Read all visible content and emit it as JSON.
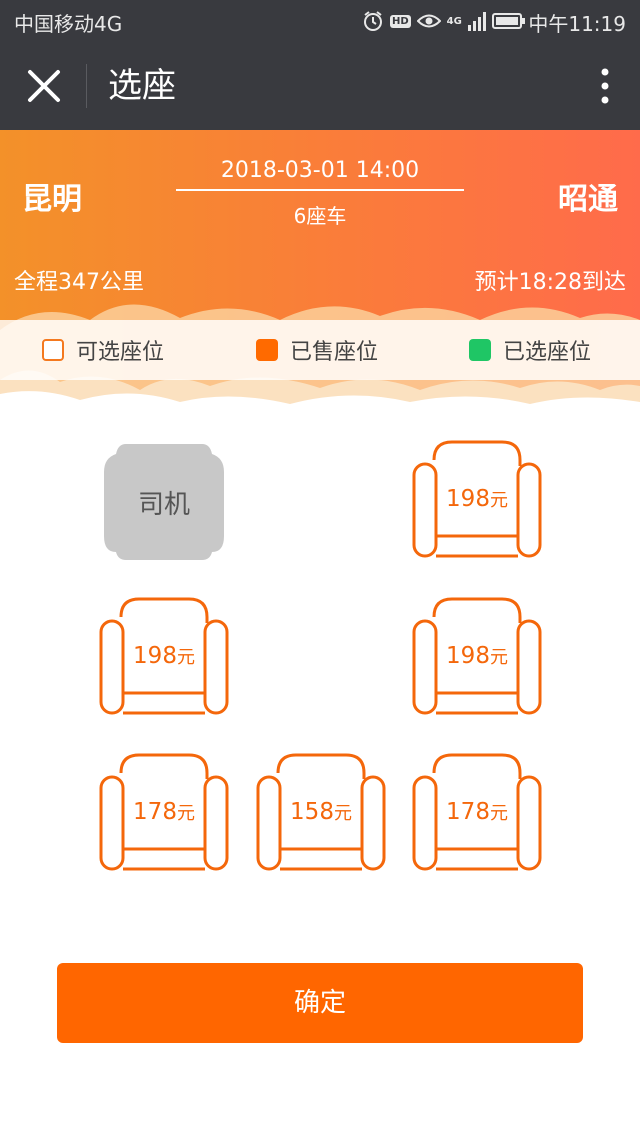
{
  "status_bar": {
    "carrier": "中国移动4G",
    "hd_label": "HD",
    "network_label": "4G",
    "time": "中午11:19",
    "icons": [
      "alarm-icon",
      "hd-icon",
      "eye-icon",
      "signal-icon",
      "battery-icon"
    ]
  },
  "nav": {
    "title": "选座",
    "close_icon": "close-icon",
    "more_icon": "more-vertical-icon"
  },
  "trip": {
    "from": "昆明",
    "to": "昭通",
    "depart_time": "2018-03-01 14:00",
    "car_type": "6座车",
    "distance": "全程347公里",
    "arrival": "预计18:28到达"
  },
  "legend": [
    {
      "label": "可选座位",
      "color": "#f4791f",
      "state": "available"
    },
    {
      "label": "已售座位",
      "color": "#ff6a00",
      "state": "sold"
    },
    {
      "label": "已选座位",
      "color": "#1fc665",
      "state": "selected"
    }
  ],
  "driver": {
    "label": "司机"
  },
  "seats": [
    {
      "price": "198",
      "unit": "元"
    },
    {
      "price": "198",
      "unit": "元"
    },
    {
      "price": "198",
      "unit": "元"
    },
    {
      "price": "178",
      "unit": "元"
    },
    {
      "price": "158",
      "unit": "元"
    },
    {
      "price": "178",
      "unit": "元"
    }
  ],
  "colors": {
    "accent": "#ff6600",
    "seat_outline": "#f4670b",
    "driver_fill": "#c8c8c8",
    "nav_bg": "#393a3f"
  },
  "confirm_label": "确定"
}
